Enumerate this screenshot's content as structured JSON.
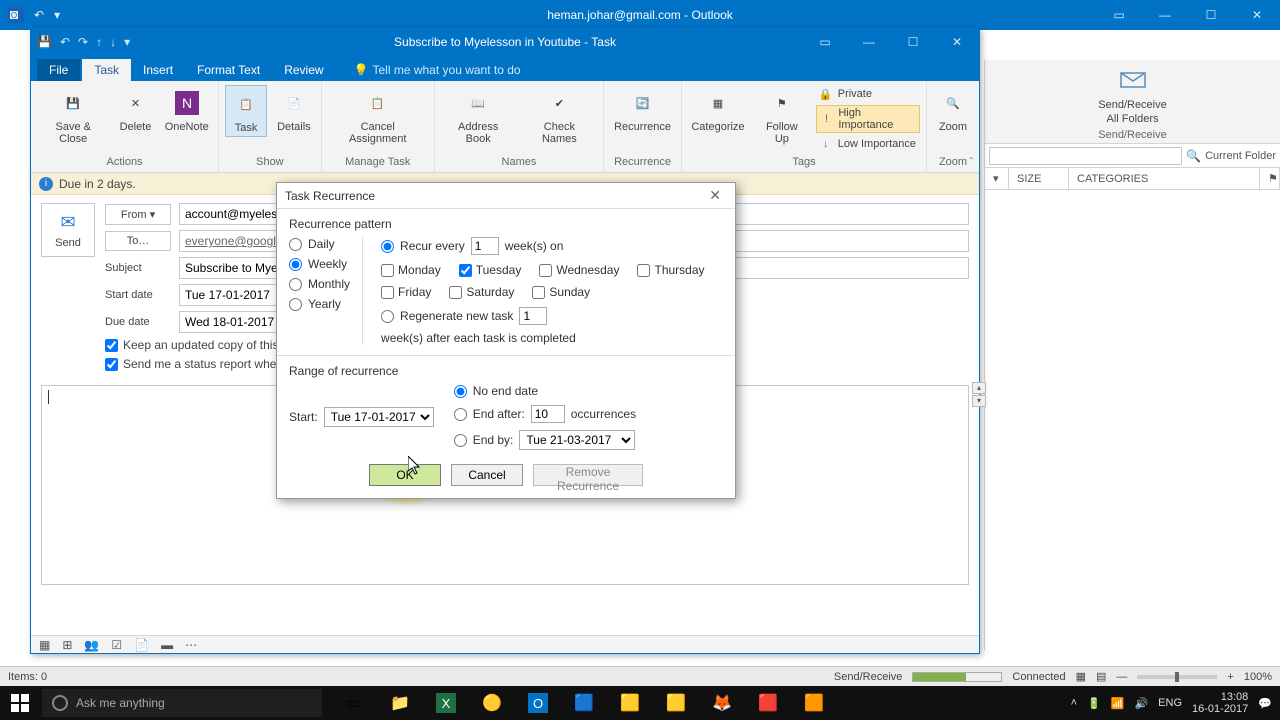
{
  "outer": {
    "title": "heman.johar@gmail.com - Outlook"
  },
  "inner": {
    "title": "Subscribe to Myelesson in Youtube  -  Task",
    "tabs": {
      "file": "File",
      "task": "Task",
      "insert": "Insert",
      "format": "Format Text",
      "review": "Review",
      "tell": "Tell me what you want to do"
    },
    "ribbon": {
      "save_close": "Save & Close",
      "delete": "Delete",
      "onenote": "OneNote",
      "task": "Task",
      "details": "Details",
      "cancel_assign": "Cancel Assignment",
      "address": "Address Book",
      "check": "Check Names",
      "recurrence": "Recurrence",
      "categorize": "Categorize",
      "followup": "Follow Up",
      "private": "Private",
      "high": "High Importance",
      "low": "Low Importance",
      "zoom": "Zoom",
      "g_actions": "Actions",
      "g_show": "Show",
      "g_manage": "Manage Task",
      "g_names": "Names",
      "g_recurrence": "Recurrence",
      "g_tags": "Tags",
      "g_zoom": "Zoom"
    },
    "infobar": "Due in 2 days.",
    "form": {
      "from_label": "From",
      "from_value": "account@myelesson.org",
      "to_label": "To…",
      "to_value": "everyone@google.com",
      "subject_label": "Subject",
      "subject_value": "Subscribe to Myelesson in Youtube",
      "start_label": "Start date",
      "start_value": "Tue 17-01-2017",
      "due_label": "Due date",
      "due_value": "Wed 18-01-2017",
      "chk1": "Keep an updated copy of this task on my task list",
      "chk2": "Send me a status report when this task is complete",
      "send": "Send"
    }
  },
  "right": {
    "sendreceive": "Send/Receive",
    "allfolders": "All Folders",
    "group": "Send/Receive",
    "search_placeholder": "",
    "scope": "Current Folder",
    "col_size": "SIZE",
    "col_cat": "CATEGORIES"
  },
  "dialog": {
    "title": "Task Recurrence",
    "pattern_label": "Recurrence pattern",
    "daily": "Daily",
    "weekly": "Weekly",
    "monthly": "Monthly",
    "yearly": "Yearly",
    "recur_every": "Recur every",
    "recur_value": "1",
    "weeks_on": "week(s) on",
    "days": {
      "mon": "Monday",
      "tue": "Tuesday",
      "wed": "Wednesday",
      "thu": "Thursday",
      "fri": "Friday",
      "sat": "Saturday",
      "sun": "Sunday"
    },
    "regen": "Regenerate new task",
    "regen_value": "1",
    "regen_after": "week(s) after each task is completed",
    "range_label": "Range of recurrence",
    "start_label": "Start:",
    "start_value": "Tue 17-01-2017",
    "noend": "No end date",
    "endafter": "End after:",
    "endafter_value": "10",
    "occurrences": "occurrences",
    "endby": "End by:",
    "endby_value": "Tue 21-03-2017",
    "ok": "OK",
    "cancel": "Cancel",
    "remove": "Remove Recurrence"
  },
  "status": {
    "items": "Items: 0",
    "sendreceive": "Send/Receive",
    "connected": "Connected",
    "zoom": "100%"
  },
  "taskbar": {
    "search": "Ask me anything",
    "time": "13:08",
    "date": "16-01-2017",
    "lang": "ENG"
  }
}
